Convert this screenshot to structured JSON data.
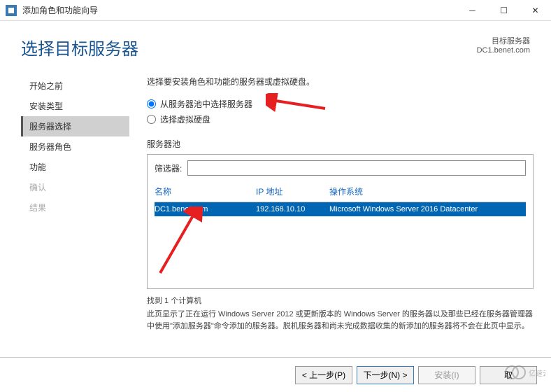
{
  "window": {
    "title": "添加角色和功能向导"
  },
  "header": {
    "page_title": "选择目标服务器",
    "dest_label": "目标服务器",
    "dest_value": "DC1.benet.com"
  },
  "sidebar": {
    "items": [
      {
        "label": "开始之前",
        "state": "normal"
      },
      {
        "label": "安装类型",
        "state": "normal"
      },
      {
        "label": "服务器选择",
        "state": "active"
      },
      {
        "label": "服务器角色",
        "state": "normal"
      },
      {
        "label": "功能",
        "state": "normal"
      },
      {
        "label": "确认",
        "state": "disabled"
      },
      {
        "label": "结果",
        "state": "disabled"
      }
    ]
  },
  "main": {
    "instruction": "选择要安装角色和功能的服务器或虚拟硬盘。",
    "radio1": "从服务器池中选择服务器",
    "radio2": "选择虚拟硬盘",
    "pool_label": "服务器池",
    "filter_label": "筛选器:",
    "filter_value": "",
    "columns": {
      "name": "名称",
      "ip": "IP 地址",
      "os": "操作系统"
    },
    "rows": [
      {
        "name": "DC1.benet.com",
        "ip": "192.168.10.10",
        "os": "Microsoft Windows Server 2016 Datacenter"
      }
    ],
    "count_text": "找到 1 个计算机",
    "desc_text": "此页显示了正在运行 Windows Server 2012 或更新版本的 Windows Server 的服务器以及那些已经在服务器管理器中使用\"添加服务器\"命令添加的服务器。脱机服务器和尚未完成数据收集的新添加的服务器将不会在此页中显示。"
  },
  "footer": {
    "prev": "< 上一步(P)",
    "next": "下一步(N) >",
    "install": "安装(I)",
    "cancel": "取"
  },
  "watermark": "亿速云"
}
